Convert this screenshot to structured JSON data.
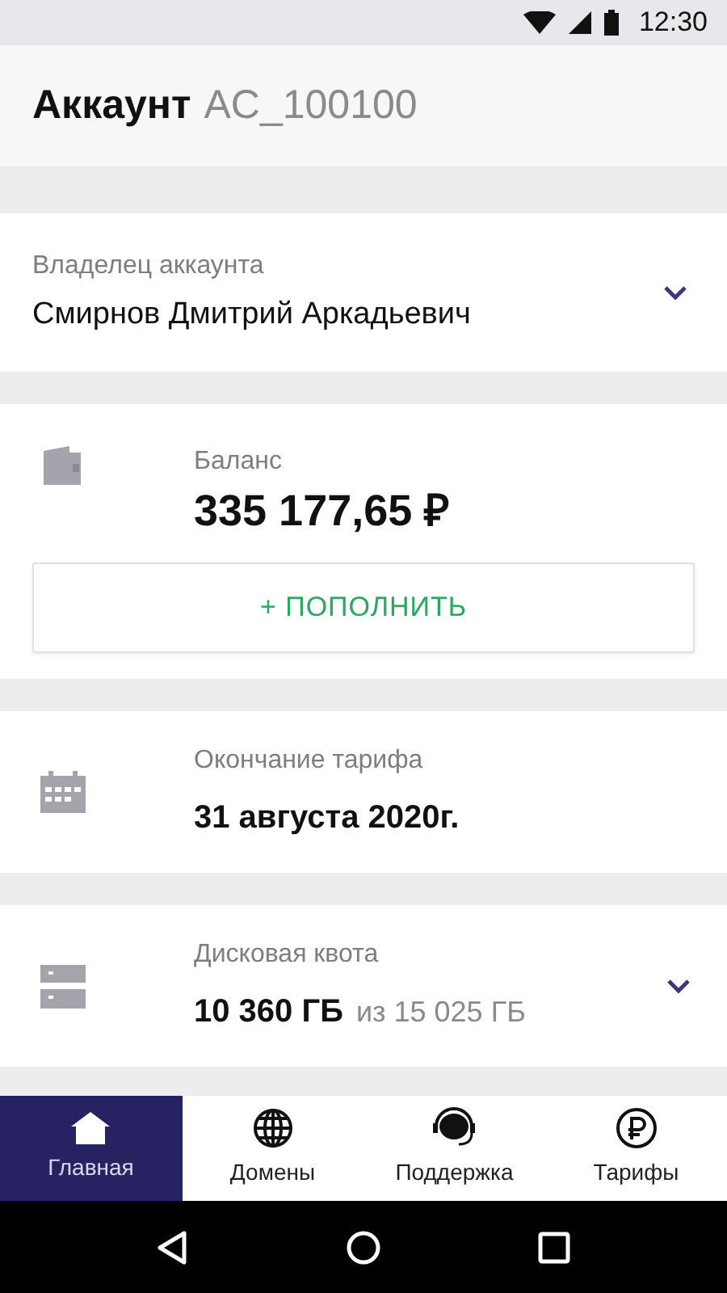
{
  "status_bar": {
    "time": "12:30"
  },
  "header": {
    "title": "Аккаунт",
    "account_id": "AC_100100"
  },
  "cards": [
    {
      "kind": "dropdown",
      "label": "Владелец аккаунта",
      "value": "Смирнов Дмитрий Аркадьевич",
      "expanded": false
    },
    {
      "kind": "balance",
      "label": "Баланс",
      "value": "335 177,65 ₽",
      "action": "+  ПОПОЛНИТЬ"
    },
    {
      "kind": "info",
      "label": "Окончание тарифа",
      "value": "31 августа 2020г."
    },
    {
      "kind": "quota",
      "label": "Дисковая квота",
      "value": "10 360 ГБ",
      "total": "из 15 025 ГБ",
      "expanded": false
    }
  ],
  "bottom_nav": [
    {
      "label": "Главная",
      "selected": true
    },
    {
      "label": "Домены",
      "selected": false
    },
    {
      "label": "Поддержка",
      "selected": false
    },
    {
      "label": "Тарифы",
      "selected": false
    }
  ]
}
